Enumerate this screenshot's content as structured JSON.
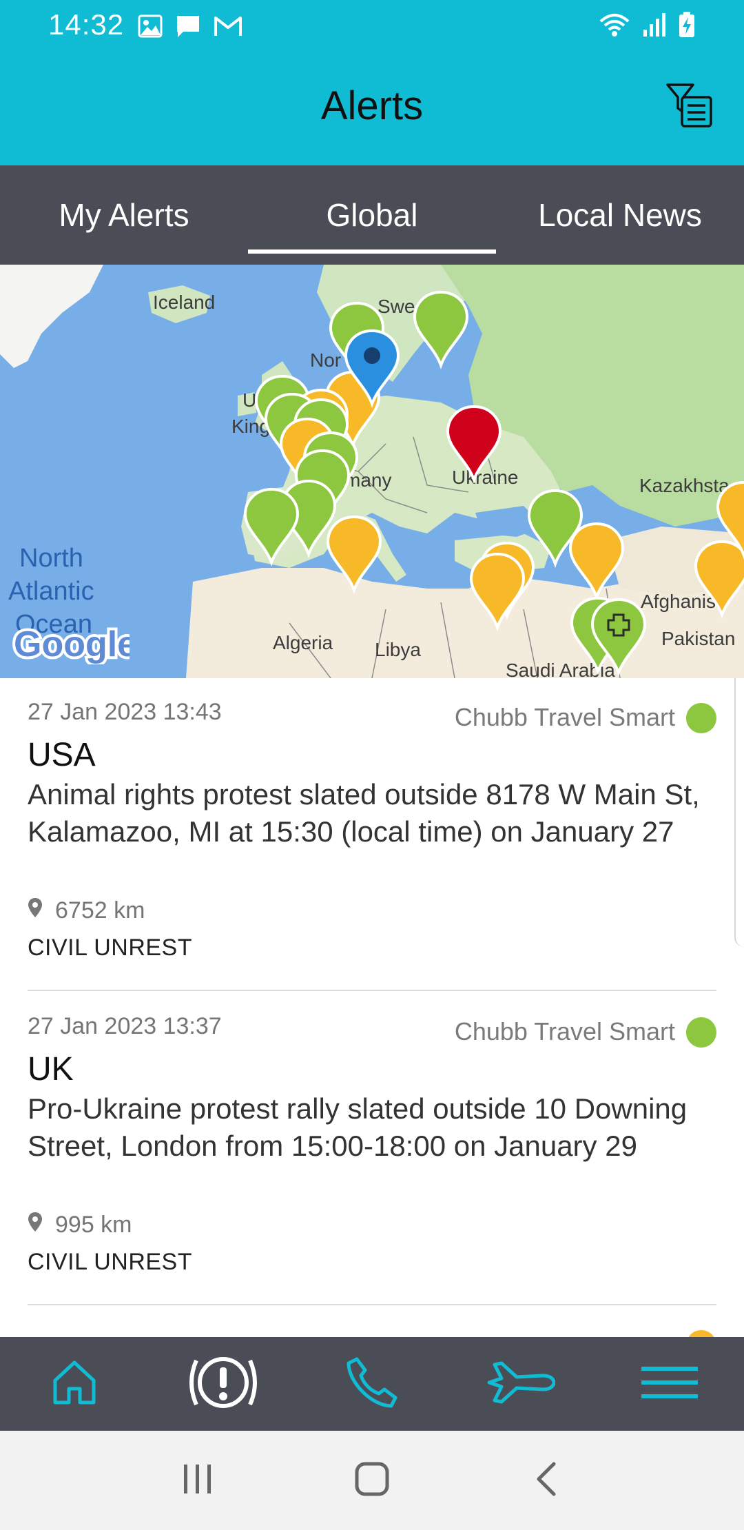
{
  "status_bar": {
    "time": "14:32"
  },
  "header": {
    "title": "Alerts"
  },
  "tabs": [
    {
      "label": "My Alerts",
      "active": false
    },
    {
      "label": "Global",
      "active": true
    },
    {
      "label": "Local News",
      "active": false
    }
  ],
  "map": {
    "labels": {
      "iceland": "Iceland",
      "sweden": "Swede",
      "norway": "Nor",
      "uk_1": "U",
      "uk_2": "King",
      "germany": "many",
      "ukraine": "Ukraine",
      "kazakhstan": "Kazakhsta",
      "north": "North",
      "atlantic": "Atlantic",
      "ocean": "Ocean",
      "algeria": "Algeria",
      "libya": "Libya",
      "afghanistan": "Afghanis",
      "pakistan": "Pakistan",
      "saudi": "Saudi Arabia"
    },
    "logo": "Google",
    "colors": {
      "green": "#8dc63f",
      "yellow": "#f7b928",
      "red": "#d0021b",
      "blue": "#2b8fe0",
      "land": "#cfe6c0",
      "water": "#77aee8"
    }
  },
  "alerts": [
    {
      "date": "27 Jan 2023 13:43",
      "source": "Chubb Travel Smart",
      "country": "USA",
      "description": "Animal rights protest slated outside 8178 W Main St, Kalamazoo, MI at 15:30 (local time) on January 27",
      "distance": "6752 km",
      "category": "CIVIL UNREST"
    },
    {
      "date": "27 Jan 2023 13:37",
      "source": "Chubb Travel Smart",
      "country": "UK",
      "description": "Pro-Ukraine protest rally slated outside 10 Downing Street, London from 15:00-18:00 on January 29",
      "distance": "995 km",
      "category": "CIVIL UNREST"
    }
  ],
  "bottom_nav": {
    "items": [
      {
        "icon": "home-icon"
      },
      {
        "icon": "alert-icon"
      },
      {
        "icon": "phone-icon"
      },
      {
        "icon": "airplane-icon"
      },
      {
        "icon": "menu-icon"
      }
    ],
    "accent": "#10bcd4"
  }
}
